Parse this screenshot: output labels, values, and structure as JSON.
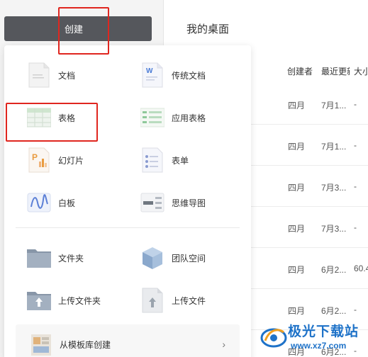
{
  "toolbar": {
    "create_label": "创建"
  },
  "main": {
    "title": "我的桌面",
    "columns": {
      "creator": "创建者",
      "recent": "最近更新",
      "size": "大小"
    },
    "rows": [
      {
        "creator": "四月",
        "recent": "7月1...",
        "size": "-"
      },
      {
        "creator": "四月",
        "recent": "7月1...",
        "size": "-"
      },
      {
        "creator": "四月",
        "recent": "7月3...",
        "size": "-"
      },
      {
        "creator": "四月",
        "recent": "7月3...",
        "size": "-"
      },
      {
        "creator": "四月",
        "recent": "6月2...",
        "size": "60.4"
      },
      {
        "creator": "四月",
        "recent": "6月2...",
        "size": "-"
      },
      {
        "creator": "四月",
        "recent": "6月2...",
        "size": "-"
      }
    ]
  },
  "menu": {
    "items": [
      {
        "label": "文档",
        "icon": "doc-icon"
      },
      {
        "label": "传统文档",
        "icon": "word-doc-icon"
      },
      {
        "label": "表格",
        "icon": "sheet-icon"
      },
      {
        "label": "应用表格",
        "icon": "app-sheet-icon"
      },
      {
        "label": "幻灯片",
        "icon": "slides-icon"
      },
      {
        "label": "表单",
        "icon": "form-icon"
      },
      {
        "label": "白板",
        "icon": "whiteboard-icon"
      },
      {
        "label": "思维导图",
        "icon": "mindmap-icon"
      },
      {
        "label": "文件夹",
        "icon": "folder-icon"
      },
      {
        "label": "团队空间",
        "icon": "team-space-icon"
      },
      {
        "label": "上传文件夹",
        "icon": "upload-folder-icon"
      },
      {
        "label": "上传文件",
        "icon": "upload-file-icon"
      }
    ],
    "template_label": "从模板库创建",
    "template_chevron": "›"
  },
  "watermark": {
    "brand": "极光下载站",
    "url": "www.xz7.com"
  },
  "colors": {
    "button": "#55575c",
    "highlight": "#e0261f",
    "watermark": "#1e72c8"
  }
}
